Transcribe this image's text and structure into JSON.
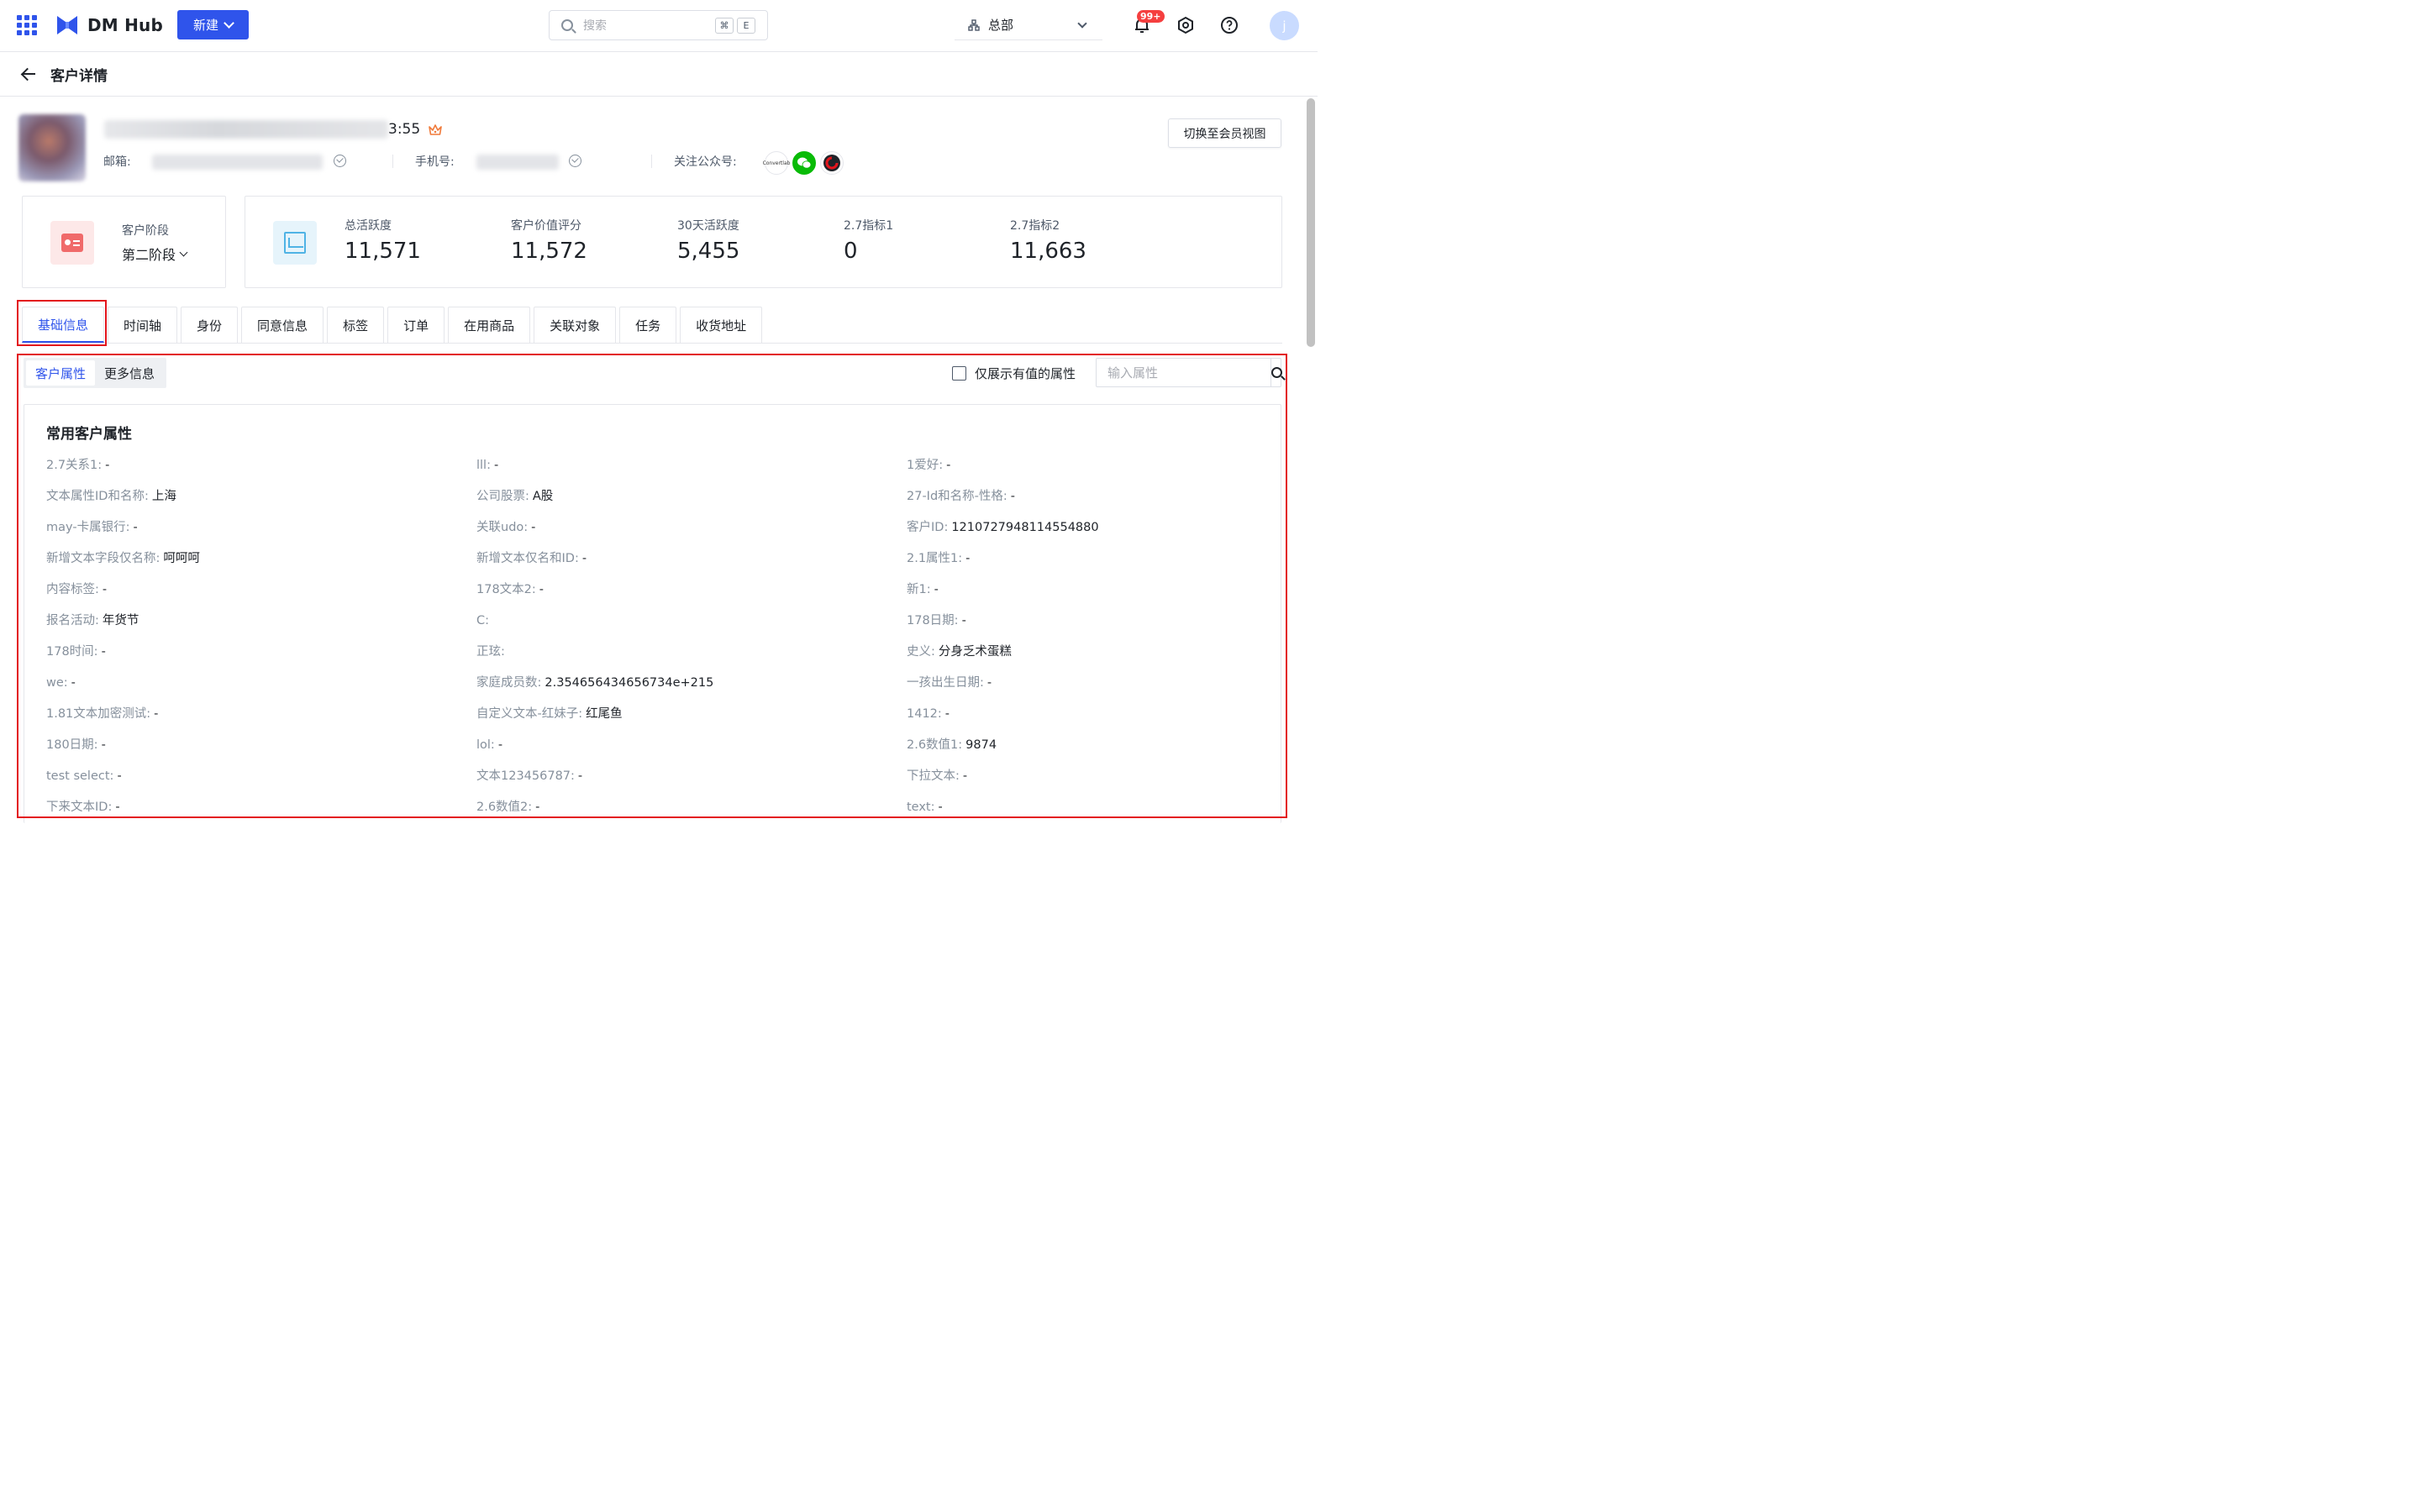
{
  "app": {
    "name": "DM Hub",
    "new_label": "新建",
    "search_placeholder": "搜索",
    "kbd1": "⌘",
    "kbd2": "E",
    "org": "总部",
    "notify_badge": "99+",
    "avatar_initial": "j"
  },
  "page": {
    "title": "客户详情"
  },
  "profile": {
    "name_tail": "3:55",
    "email_label": "邮箱:",
    "phone_label": "手机号:",
    "follow_label": "关注公众号:",
    "accounts": [
      "Convertlab",
      "wechat",
      "C"
    ],
    "switch_label": "切换至会员视图"
  },
  "stage": {
    "label": "客户阶段",
    "value": "第二阶段"
  },
  "metrics": [
    {
      "label": "总活跃度",
      "value": "11,571"
    },
    {
      "label": "客户价值评分",
      "value": "11,572"
    },
    {
      "label": "30天活跃度",
      "value": "5,455"
    },
    {
      "label": "2.7指标1",
      "value": "0"
    },
    {
      "label": "2.7指标2",
      "value": "11,663"
    }
  ],
  "tabs": [
    "基础信息",
    "时间轴",
    "身份",
    "同意信息",
    "标签",
    "订单",
    "在用商品",
    "关联对象",
    "任务",
    "收货地址"
  ],
  "subtabs": [
    "客户属性",
    "更多信息"
  ],
  "filter": {
    "only_valued_label": "仅展示有值的属性",
    "attr_placeholder": "输入属性"
  },
  "section_title": "常用客户属性",
  "attributes": [
    {
      "k": "2.7关系1:",
      "v": "-"
    },
    {
      "k": "lll:",
      "v": "-"
    },
    {
      "k": "1爱好:",
      "v": "-"
    },
    {
      "k": "文本属性ID和名称:",
      "v": "上海"
    },
    {
      "k": "公司股票:",
      "v": "A股"
    },
    {
      "k": "27-Id和名称-性格:",
      "v": "-"
    },
    {
      "k": "may-卡属银行:",
      "v": "-"
    },
    {
      "k": "关联udo:",
      "v": "-"
    },
    {
      "k": "客户ID:",
      "v": "1210727948114554880"
    },
    {
      "k": "新增文本字段仅名称:",
      "v": "呵呵呵"
    },
    {
      "k": "新增文本仅名和ID:",
      "v": "-"
    },
    {
      "k": "2.1属性1:",
      "v": "-"
    },
    {
      "k": "内容标签:",
      "v": "-"
    },
    {
      "k": "178文本2:",
      "v": "-"
    },
    {
      "k": "新1:",
      "v": "-"
    },
    {
      "k": "报名活动:",
      "v": "年货节"
    },
    {
      "k": "C:",
      "v": ""
    },
    {
      "k": "178日期:",
      "v": "-"
    },
    {
      "k": "178时间:",
      "v": "-"
    },
    {
      "k": "正玹:",
      "v": ""
    },
    {
      "k": "史义:",
      "v": "分身乏术蛋糕"
    },
    {
      "k": "we:",
      "v": "-"
    },
    {
      "k": "家庭成员数:",
      "v": "2.354656434656734e+215"
    },
    {
      "k": "一孩出生日期:",
      "v": "-"
    },
    {
      "k": "1.81文本加密测试:",
      "v": "-"
    },
    {
      "k": "自定义文本-红妹子:",
      "v": "红尾鱼"
    },
    {
      "k": "1412:",
      "v": "-"
    },
    {
      "k": "180日期:",
      "v": "-"
    },
    {
      "k": "lol:",
      "v": "-"
    },
    {
      "k": "2.6数值1:",
      "v": "9874"
    },
    {
      "k": "test select:",
      "v": "-"
    },
    {
      "k": "文本123456787:",
      "v": "-"
    },
    {
      "k": "下拉文本:",
      "v": "-"
    },
    {
      "k": "下来文本ID:",
      "v": "-"
    },
    {
      "k": "2.6数值2:",
      "v": "-"
    },
    {
      "k": "text:",
      "v": "-"
    }
  ]
}
